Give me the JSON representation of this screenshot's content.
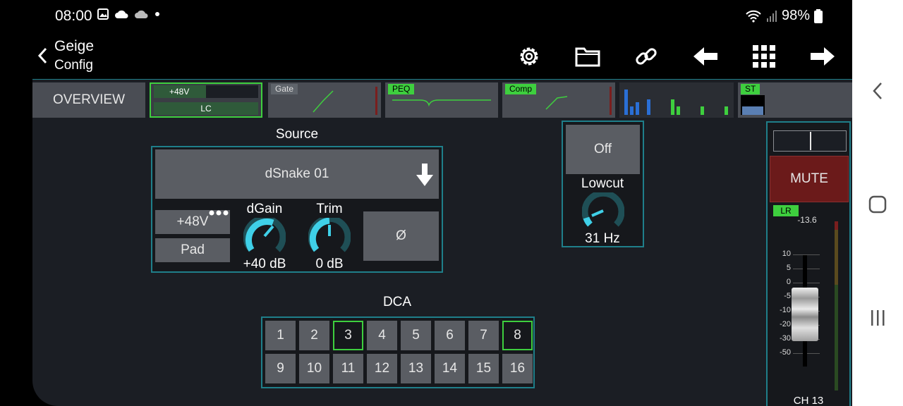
{
  "status_bar": {
    "time": "08:00",
    "battery": "98%"
  },
  "header": {
    "title": "Geige",
    "subtitle": "Config"
  },
  "toolbar_icons": [
    "gear-icon",
    "folder-icon",
    "link-icon",
    "arrow-left-icon",
    "grid-icon",
    "arrow-right-icon"
  ],
  "strip": {
    "overview": "OVERVIEW",
    "phantom": "+48V",
    "lowcut": "LC",
    "gate": "Gate",
    "peq": "PEQ",
    "comp": "Comp",
    "st": "ST"
  },
  "source": {
    "label": "Source",
    "selected": "dSnake 01",
    "phantom_btn": "+48V",
    "pad_btn": "Pad",
    "phase_btn": "Ø",
    "dgain_label": "dGain",
    "dgain_value": "+40 dB",
    "trim_label": "Trim",
    "trim_value": "0 dB"
  },
  "lowcut": {
    "state": "Off",
    "label": "Lowcut",
    "value": "31 Hz"
  },
  "dca": {
    "label": "DCA",
    "row1": [
      "1",
      "2",
      "3",
      "4",
      "5",
      "6",
      "7",
      "8"
    ],
    "row2": [
      "9",
      "10",
      "11",
      "12",
      "13",
      "14",
      "15",
      "16"
    ],
    "selected": [
      "3",
      "8"
    ]
  },
  "channel": {
    "mute": "MUTE",
    "bus": "LR",
    "level": "-13.6",
    "scale": [
      "10",
      "5",
      "0",
      "-5",
      "-10",
      "-20",
      "-30",
      "-50"
    ],
    "name": "CH 13"
  },
  "colors": {
    "accent": "#1f7f8a",
    "active_green": "#3ecf3e",
    "mute_red": "#6b1a1a",
    "knob_cyan": "#3fd0e8"
  }
}
